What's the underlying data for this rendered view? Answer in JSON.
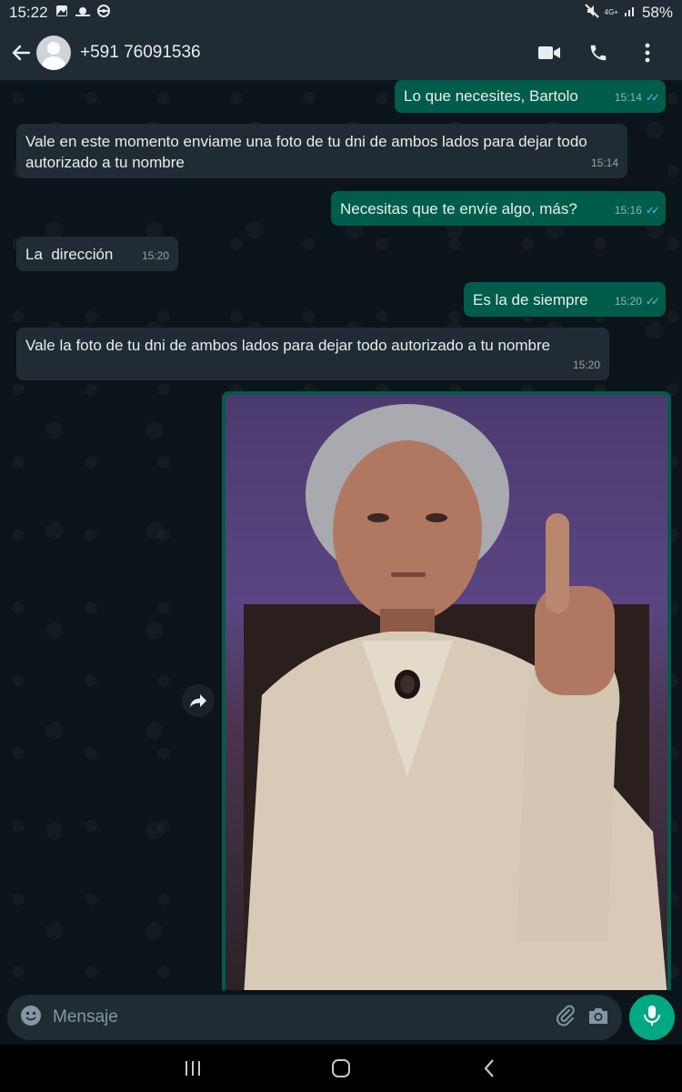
{
  "status_bar": {
    "time": "15:22",
    "battery": "58%",
    "network": "4G+"
  },
  "header": {
    "contact": "+591 76091536"
  },
  "messages": [
    {
      "text": "Lo que necesites, Bartolo",
      "time": "15:14",
      "dir": "out"
    },
    {
      "text": "Vale en este momento enviame una foto de tu dni de ambos lados para dejar todo autorizado a tu nombre",
      "time": "15:14",
      "dir": "in"
    },
    {
      "text": "Necesitas que te envíe algo, más?",
      "time": "15:16",
      "dir": "out"
    },
    {
      "text": "La  dirección",
      "time": "15:20",
      "dir": "in"
    },
    {
      "text": "Es la de siempre",
      "time": "15:20",
      "dir": "out"
    },
    {
      "text": "Vale la foto de tu dni de ambos lados para dejar todo autorizado a tu nombre",
      "time": "15:20",
      "dir": "in"
    }
  ],
  "input": {
    "placeholder": "Mensaje"
  },
  "icons": {
    "back": "back-arrow-icon",
    "video": "video-call-icon",
    "call": "phone-icon",
    "menu": "more-vert-icon",
    "emoji": "emoji-icon",
    "attach": "attach-icon",
    "camera": "camera-icon",
    "mic": "mic-icon"
  },
  "colors": {
    "outgoing": "#005c4b",
    "incoming": "#202c33",
    "accent": "#00a884"
  }
}
